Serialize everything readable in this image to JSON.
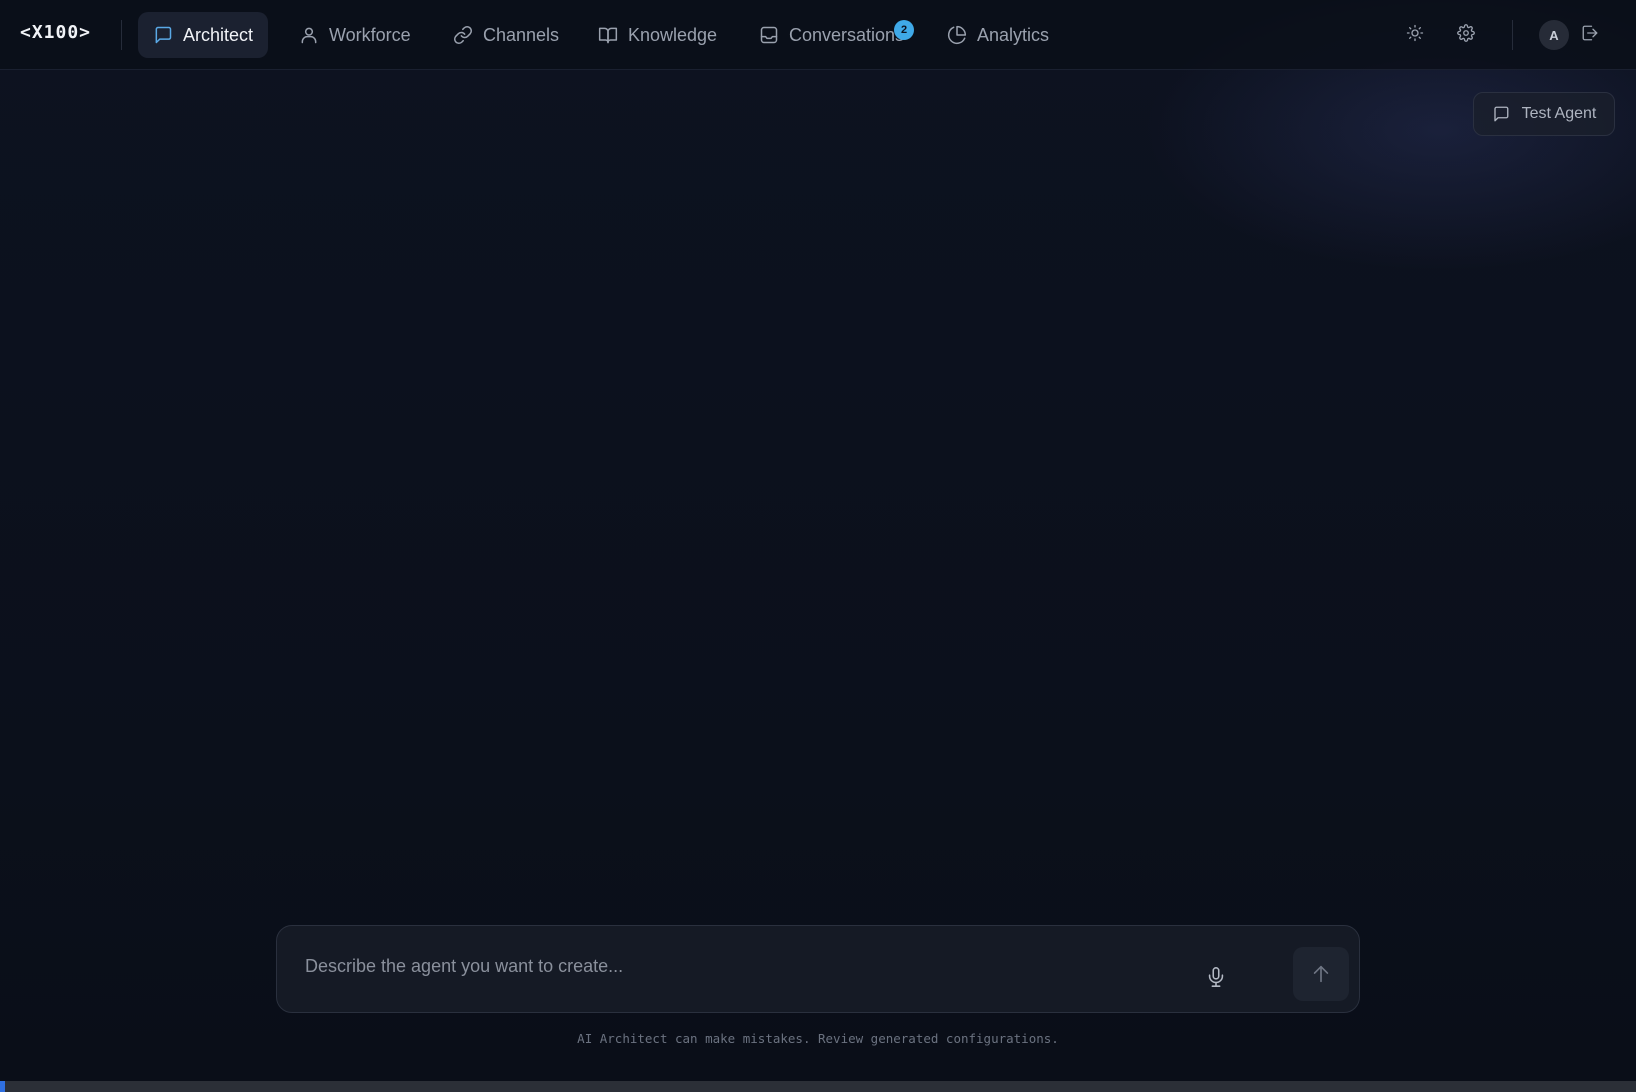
{
  "app": {
    "logo": "<X100>"
  },
  "nav": {
    "tabs": [
      {
        "label": "Architect",
        "icon": "chat-bubble-icon",
        "active": true
      },
      {
        "label": "Workforce",
        "icon": "users-icon",
        "active": false
      },
      {
        "label": "Channels",
        "icon": "link-icon",
        "active": false
      },
      {
        "label": "Knowledge",
        "icon": "book-icon",
        "active": false
      },
      {
        "label": "Conversations",
        "icon": "inbox-icon",
        "active": false,
        "badge": "2"
      },
      {
        "label": "Analytics",
        "icon": "pie-chart-icon",
        "active": false
      }
    ]
  },
  "header_actions": {
    "theme_icon": "sun-icon",
    "settings_icon": "gear-icon",
    "avatar_initial": "A",
    "logout_icon": "logout-icon"
  },
  "test_agent": {
    "label": "Test Agent",
    "icon": "message-square-icon"
  },
  "composer": {
    "placeholder": "Describe the agent you want to create...",
    "value": "",
    "mic_icon": "microphone-icon",
    "send_icon": "arrow-up-icon"
  },
  "disclaimer": "AI Architect can make mistakes. Review generated configurations.",
  "progress": {
    "fraction": 0.003
  },
  "colors": {
    "background": "#0c111c",
    "accent_badge": "#3fa9e8",
    "progress": "#2f6fe0"
  }
}
